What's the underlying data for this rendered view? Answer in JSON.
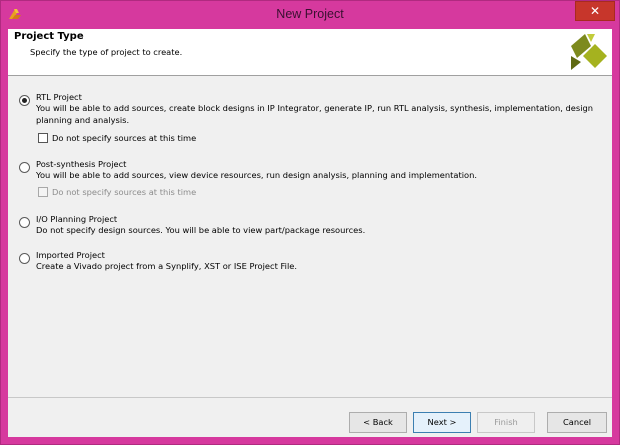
{
  "window": {
    "title": "New Project",
    "close_label": "✕"
  },
  "header": {
    "title": "Project Type",
    "subtitle": "Specify the type of project to create."
  },
  "options": [
    {
      "title": "RTL Project",
      "description": "You will be able to add sources, create block designs in IP Integrator, generate IP, run RTL analysis, synthesis, implementation, design planning and analysis.",
      "checked": true,
      "checkbox_label": "Do not specify sources at this time",
      "checkbox_enabled": true
    },
    {
      "title": "Post-synthesis Project",
      "description": "You will be able to add sources, view device resources, run design analysis, planning and implementation.",
      "checked": false,
      "checkbox_label": "Do not specify sources at this time",
      "checkbox_enabled": false
    },
    {
      "title": "I/O Planning Project",
      "description": "Do not specify design sources. You will be able to view part/package resources.",
      "checked": false
    },
    {
      "title": "Imported Project",
      "description": "Create a Vivado project from a Synplify, XST or ISE Project File.",
      "checked": false
    }
  ],
  "buttons": {
    "back": "< Back",
    "next": "Next >",
    "finish": "Finish",
    "cancel": "Cancel"
  },
  "colors": {
    "window_frame": "#d6399e",
    "close_button": "#c7362b",
    "logo_green": "#7d8a1e"
  }
}
